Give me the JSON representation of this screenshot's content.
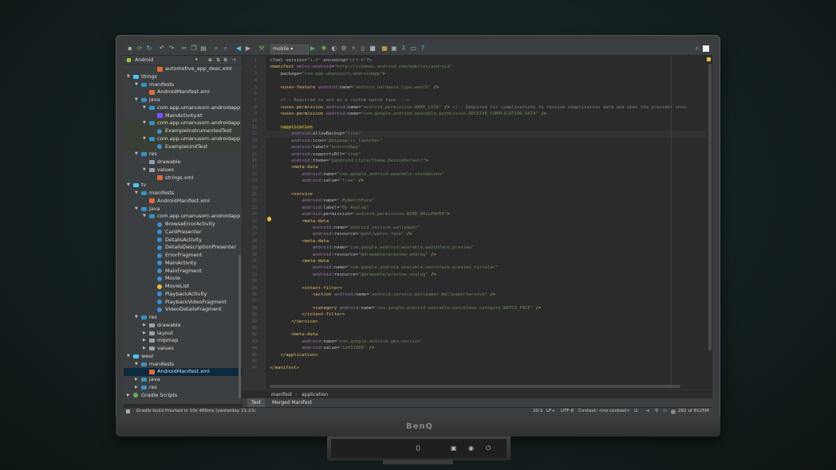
{
  "monitor": {
    "brand": "BenQ"
  },
  "toolbar": {
    "run_config": "mobile"
  },
  "project_panel": {
    "view_selector": "Android",
    "items": [
      {
        "label": "automotive_app_desc.xml",
        "depth": 3,
        "icon": "xml",
        "arrow": ""
      },
      {
        "label": "things",
        "depth": 0,
        "icon": "module",
        "arrow": "down"
      },
      {
        "label": "manifests",
        "depth": 1,
        "icon": "folder",
        "arrow": "down"
      },
      {
        "label": "AndroidManifest.xml",
        "depth": 2,
        "icon": "xml",
        "arrow": ""
      },
      {
        "label": "java",
        "depth": 1,
        "icon": "folder",
        "arrow": "down"
      },
      {
        "label": "com.app.umanusorn.androidapp",
        "depth": 2,
        "icon": "package",
        "arrow": "down"
      },
      {
        "label": "MainActivity.kt",
        "depth": 3,
        "icon": "kt",
        "arrow": ""
      },
      {
        "label": "com.app.umanusorn.androidapp",
        "depth": 2,
        "icon": "package",
        "arrow": "down",
        "shaded": true
      },
      {
        "label": "ExampleInstrumentedTest",
        "depth": 3,
        "icon": "class",
        "arrow": "",
        "shaded": true
      },
      {
        "label": "com.app.umanusorn.androidapp",
        "depth": 2,
        "icon": "package",
        "arrow": "down",
        "shaded": true
      },
      {
        "label": "ExampleUnitTest",
        "depth": 3,
        "icon": "class",
        "arrow": "",
        "shaded": true
      },
      {
        "label": "res",
        "depth": 1,
        "icon": "folder",
        "arrow": "down"
      },
      {
        "label": "drawable",
        "depth": 2,
        "icon": "folder-gray",
        "arrow": ""
      },
      {
        "label": "values",
        "depth": 2,
        "icon": "folder-gray",
        "arrow": "down"
      },
      {
        "label": "strings.xml",
        "depth": 3,
        "icon": "xml",
        "arrow": ""
      },
      {
        "label": "tv",
        "depth": 0,
        "icon": "module",
        "arrow": "down"
      },
      {
        "label": "manifests",
        "depth": 1,
        "icon": "folder",
        "arrow": "down"
      },
      {
        "label": "AndroidManifest.xml",
        "depth": 2,
        "icon": "xml",
        "arrow": ""
      },
      {
        "label": "java",
        "depth": 1,
        "icon": "folder",
        "arrow": "down"
      },
      {
        "label": "com.app.umanusorn.androidapp",
        "depth": 2,
        "icon": "package",
        "arrow": "down"
      },
      {
        "label": "BrowseErrorActivity",
        "depth": 3,
        "icon": "class",
        "arrow": ""
      },
      {
        "label": "CardPresenter",
        "depth": 3,
        "icon": "class",
        "arrow": ""
      },
      {
        "label": "DetailsActivity",
        "depth": 3,
        "icon": "class",
        "arrow": ""
      },
      {
        "label": "DetailsDescriptionPresenter",
        "depth": 3,
        "icon": "class",
        "arrow": ""
      },
      {
        "label": "ErrorFragment",
        "depth": 3,
        "icon": "class",
        "arrow": ""
      },
      {
        "label": "MainActivity",
        "depth": 3,
        "icon": "class",
        "arrow": ""
      },
      {
        "label": "MainFragment",
        "depth": 3,
        "icon": "class",
        "arrow": ""
      },
      {
        "label": "Movie",
        "depth": 3,
        "icon": "class",
        "arrow": ""
      },
      {
        "label": "MovieList",
        "depth": 3,
        "icon": "yellow",
        "arrow": ""
      },
      {
        "label": "PlaybackActivity",
        "depth": 3,
        "icon": "class",
        "arrow": ""
      },
      {
        "label": "PlaybackVideoFragment",
        "depth": 3,
        "icon": "class",
        "arrow": ""
      },
      {
        "label": "VideoDetailsFragment",
        "depth": 3,
        "icon": "class",
        "arrow": ""
      },
      {
        "label": "res",
        "depth": 1,
        "icon": "folder",
        "arrow": "down"
      },
      {
        "label": "drawable",
        "depth": 2,
        "icon": "folder-gray",
        "arrow": "right"
      },
      {
        "label": "layout",
        "depth": 2,
        "icon": "folder-gray",
        "arrow": "right"
      },
      {
        "label": "mipmap",
        "depth": 2,
        "icon": "folder-gray",
        "arrow": "right"
      },
      {
        "label": "values",
        "depth": 2,
        "icon": "folder-gray",
        "arrow": "right"
      },
      {
        "label": "wear",
        "depth": 0,
        "icon": "module",
        "arrow": "down"
      },
      {
        "label": "manifests",
        "depth": 1,
        "icon": "folder",
        "arrow": "down"
      },
      {
        "label": "AndroidManifest.xml",
        "depth": 2,
        "icon": "xml",
        "arrow": "",
        "selected": true
      },
      {
        "label": "java",
        "depth": 1,
        "icon": "folder",
        "arrow": "right"
      },
      {
        "label": "res",
        "depth": 1,
        "icon": "folder",
        "arrow": "right"
      },
      {
        "label": "Gradle Scripts",
        "depth": 0,
        "icon": "gradle",
        "arrow": "right"
      }
    ]
  },
  "editor": {
    "caret_line": 12,
    "lines": [
      {
        "n": "1",
        "html": "&lt;?xml version=<span class='v'>\"1.0\"</span> encoding=<span class='v'>\"utf-8\"</span>?&gt;"
      },
      {
        "n": "2",
        "html": "<span class='t'>&lt;manifest</span> <span class='ns'>xmlns:android</span>=<span class='v'>\"http://schemas.android.com/apk/res/android\"</span>"
      },
      {
        "n": "3",
        "html": "    <span class='a'>package</span>=<span class='v'>\"com.app.umanusorn.androidapp\"</span><span class='t'>&gt;</span>"
      },
      {
        "n": "4",
        "html": ""
      },
      {
        "n": "5",
        "html": "    <span class='t'>&lt;uses-feature</span> <span class='ns'>android</span>:<span class='a'>name</span>=<span class='v'>\"android.hardware.type.watch\"</span> <span class='t'>/&gt;</span>"
      },
      {
        "n": "6",
        "html": ""
      },
      {
        "n": "7",
        "html": "    <span class='c'>&lt;!-- Required to act as a custom watch face. --&gt;</span>"
      },
      {
        "n": "8",
        "html": "    <span class='t'>&lt;uses-permission</span> <span class='ns'>android</span>:<span class='a'>name</span>=<span class='v'>\"android.permission.WAKE_LOCK\"</span> <span class='t'>/&gt;</span> <span class='c'>&lt;!-- Required for complications to receive complication data and open the provider choo</span>"
      },
      {
        "n": "9",
        "html": "    <span class='t'>&lt;uses-permission</span> <span class='ns'>android</span>:<span class='a'>name</span>=<span class='v'>\"com.google.android.wearable.permission.RECEIVE_COMPLICATION_DATA\"</span> <span class='t'>/&gt;</span>"
      },
      {
        "n": "10",
        "html": ""
      },
      {
        "n": "11",
        "html": "    <span class='t tag-hl'>&lt;application</span>"
      },
      {
        "n": "12",
        "html": "        <span class='ns'>android</span>:<span class='a'>allowBackup</span>=<span class='v'>\"true\"</span>"
      },
      {
        "n": "13",
        "html": "        <span class='ns'>android</span>:<span class='a'>icon</span>=<span class='v'>\"@mipmap/ic_launcher\"</span>"
      },
      {
        "n": "14",
        "html": "        <span class='ns'>android</span>:<span class='a'>label</span>=<span class='v'>\"AndroidApp\"</span>"
      },
      {
        "n": "15",
        "html": "        <span class='ns'>android</span>:<span class='a'>supportsRtl</span>=<span class='v'>\"true\"</span>"
      },
      {
        "n": "16",
        "html": "        <span class='ns'>android</span>:<span class='a'>theme</span>=<span class='v'>\"@android:style/Theme.DeviceDefault\"</span><span class='t'>&gt;</span>"
      },
      {
        "n": "17",
        "html": "        <span class='t'>&lt;meta-data</span>"
      },
      {
        "n": "18",
        "html": "            <span class='ns'>android</span>:<span class='a'>name</span>=<span class='v'>\"com.google.android.wearable.standalone\"</span>"
      },
      {
        "n": "19",
        "html": "            <span class='ns'>android</span>:<span class='a'>value</span>=<span class='v'>\"true\"</span> <span class='t'>/&gt;</span>"
      },
      {
        "n": "20",
        "html": ""
      },
      {
        "n": "21",
        "html": "        <span class='t'>&lt;service</span>"
      },
      {
        "n": "22",
        "html": "            <span class='ns'>android</span>:<span class='a'>name</span>=<span class='v'>\".MyWatchFace\"</span>"
      },
      {
        "n": "23",
        "html": "            <span class='ns'>android</span>:<span class='a'>label</span>=<span class='v'>\"My Analog\"</span>"
      },
      {
        "n": "24",
        "html": "            <span class='ns'>android</span>:<span class='a'>permission</span>=<span class='v'>\"android.permission.BIND_WALLPAPER\"</span><span class='t'>&gt;</span>"
      },
      {
        "n": "25",
        "html": "            <span class='t'>&lt;meta-data</span>"
      },
      {
        "n": "26",
        "html": "                <span class='ns'>android</span>:<span class='a'>name</span>=<span class='v'>\"android.service.wallpaper\"</span>"
      },
      {
        "n": "27",
        "html": "                <span class='ns'>android</span>:<span class='a'>resource</span>=<span class='v'>\"@xml/watch_face\"</span> <span class='t'>/&gt;</span>"
      },
      {
        "n": "28",
        "html": "            <span class='t'>&lt;meta-data</span>"
      },
      {
        "n": "29",
        "html": "                <span class='ns'>android</span>:<span class='a'>name</span>=<span class='v'>\"com.google.android.wearable.watchface.preview\"</span>"
      },
      {
        "n": "30",
        "html": "                <span class='ns'>android</span>:<span class='a'>resource</span>=<span class='v'>\"@drawable/preview_analog\"</span> <span class='t'>/&gt;</span>"
      },
      {
        "n": "31",
        "html": "            <span class='t'>&lt;meta-data</span>"
      },
      {
        "n": "32",
        "html": "                <span class='ns'>android</span>:<span class='a'>name</span>=<span class='v'>\"com.google.android.wearable.watchface.preview_circular\"</span>"
      },
      {
        "n": "33",
        "html": "                <span class='ns'>android</span>:<span class='a'>resource</span>=<span class='v'>\"@drawable/preview_analog\"</span> <span class='t'>/&gt;</span>"
      },
      {
        "n": "34",
        "html": ""
      },
      {
        "n": "35",
        "html": "            <span class='t'>&lt;intent-filter&gt;</span>"
      },
      {
        "n": "36",
        "html": "                <span class='t'>&lt;action</span> <span class='ns'>android</span>:<span class='a'>name</span>=<span class='v'>\"android.service.wallpaper.WallpaperService\"</span> <span class='t'>/&gt;</span>"
      },
      {
        "n": "37",
        "html": ""
      },
      {
        "n": "38",
        "html": "                <span class='t'>&lt;category</span> <span class='ns'>android</span>:<span class='a'>name</span>=<span class='v'>\"com.google.android.wearable.watchface.category.WATCH_FACE\"</span> <span class='t'>/&gt;</span>"
      },
      {
        "n": "39",
        "html": "            <span class='t'>&lt;/intent-filter&gt;</span>"
      },
      {
        "n": "40",
        "html": "        <span class='t'>&lt;/service&gt;</span>"
      },
      {
        "n": "41",
        "html": ""
      },
      {
        "n": "42",
        "html": "        <span class='t'>&lt;meta-data</span>"
      },
      {
        "n": "43",
        "html": "            <span class='ns'>android</span>:<span class='a'>name</span>=<span class='v'>\"com.google.android.gms.version\"</span>"
      },
      {
        "n": "44",
        "html": "            <span class='ns'>android</span>:<span class='a'>value</span>=<span class='v'>\"12451000\"</span> <span class='t'>/&gt;</span>"
      },
      {
        "n": "45",
        "html": "    <span class='t'>&lt;/application&gt;</span>"
      },
      {
        "n": "46",
        "html": ""
      },
      {
        "n": "47",
        "html": "<span class='t'>&lt;/manifest&gt;</span>"
      }
    ]
  },
  "breadcrumb": {
    "first": "manifest",
    "separator": "›",
    "second": "application"
  },
  "bottom_tabs": {
    "text": "Text",
    "merged": "Merged Manifest"
  },
  "status": {
    "message": "Gradle build finished in 10s 486ms (yesterday 21:23)",
    "position": "20:1",
    "line_sep": "LF÷",
    "encoding": "UTF-8",
    "context": "Context: <no context>",
    "memory": "282 of 8125M"
  }
}
